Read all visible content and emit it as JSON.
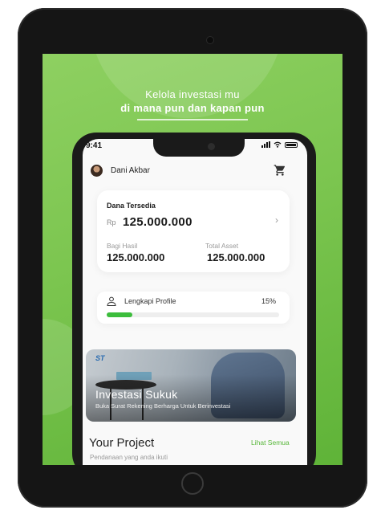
{
  "headline": {
    "line1": "Kelola investasi mu",
    "line2": "di mana pun dan kapan pun"
  },
  "status_bar": {
    "time": "9:41"
  },
  "user": {
    "name": "Dani Akbar"
  },
  "balance_card": {
    "label": "Dana Tersedia",
    "currency": "Rp",
    "value": "125.000.000",
    "chevron": "›",
    "bagi_hasil_label": "Bagi Hasil",
    "bagi_hasil_value": "125.000.000",
    "total_asset_label": "Total Asset",
    "total_asset_value": "125.000.000"
  },
  "profile_card": {
    "label": "Lengkapi Profile",
    "percent_text": "15%",
    "progress": 0.15
  },
  "banner": {
    "logo": "ST",
    "title": "Investasi Sukuk",
    "subtitle": "Buka Surat Rekening Berharga Untuk Berinvestasi"
  },
  "project": {
    "title": "Your Project",
    "link": "Lihat Semua",
    "subtitle": "Pendanaan yang anda ikuti"
  },
  "colors": {
    "accent_green": "#58b73a",
    "progress_green": "#3cbd3c",
    "background_green": "#7bc54f"
  },
  "icons": {
    "cart": "cart-icon",
    "profile": "user-outline-icon",
    "wifi": "wifi-icon",
    "battery": "battery-icon"
  }
}
